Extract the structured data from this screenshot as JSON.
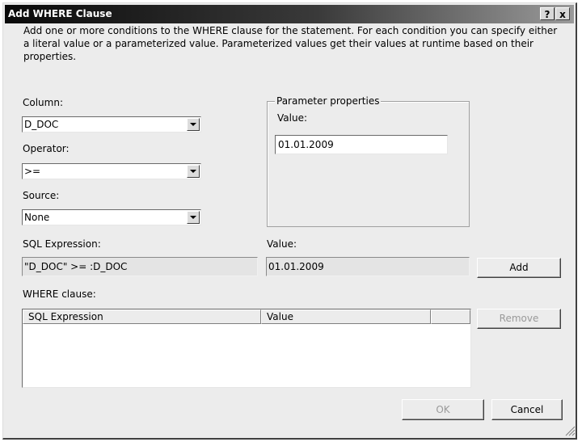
{
  "window": {
    "title": "Add WHERE Clause",
    "help_label": "?",
    "close_label": "x"
  },
  "intro": "Add one or more conditions to the WHERE clause for the statement. For each condition you can specify either a literal value or a parameterized value. Parameterized values get their values at runtime based on their properties.",
  "column": {
    "label": "Column:",
    "value": "D_DOC"
  },
  "operator": {
    "label": "Operator:",
    "value": ">="
  },
  "source": {
    "label": "Source:",
    "value": "None"
  },
  "parameter_properties": {
    "title": "Parameter properties",
    "value_label": "Value:",
    "value": "01.01.2009"
  },
  "sql_expression": {
    "label": "SQL Expression:",
    "value": "\"D_DOC\" >= :D_DOC"
  },
  "value_field": {
    "label": "Value:",
    "value": "01.01.2009"
  },
  "where_clause": {
    "label": "WHERE clause:",
    "columns": [
      "SQL Expression",
      "Value",
      ""
    ],
    "rows": []
  },
  "buttons": {
    "add": "Add",
    "remove": "Remove",
    "ok": "OK",
    "cancel": "Cancel"
  }
}
